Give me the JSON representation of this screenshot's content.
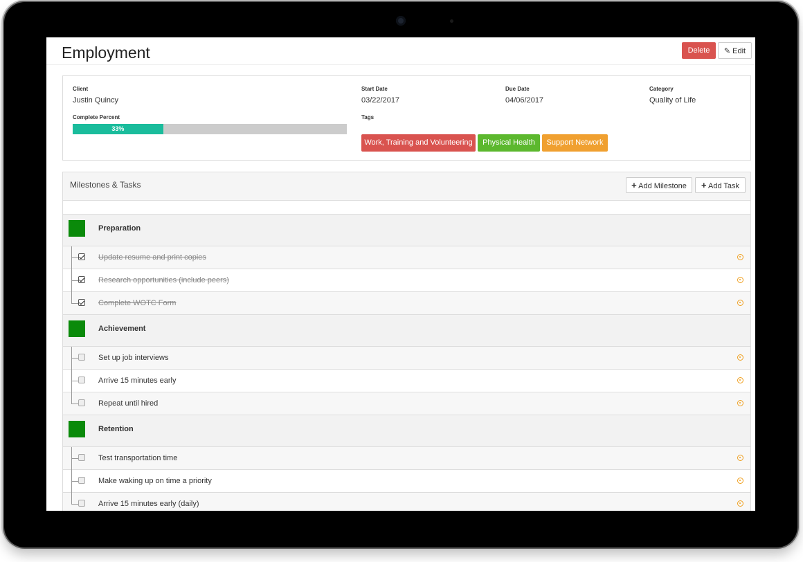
{
  "page": {
    "title": "Employment",
    "delete_label": "Delete",
    "edit_label": "Edit"
  },
  "info": {
    "client_label": "Client",
    "client_value": "Justin Quincy",
    "start_label": "Start Date",
    "start_value": "03/22/2017",
    "due_label": "Due Date",
    "due_value": "04/06/2017",
    "category_label": "Category",
    "category_value": "Quality of Life",
    "complete_label": "Complete Percent",
    "complete_value": "33%",
    "complete_fraction": 0.33,
    "tags_label": "Tags",
    "tags": [
      {
        "label": "Work, Training and Volunteering",
        "color": "#d9534f"
      },
      {
        "label": "Physical Health",
        "color": "#5cb82e"
      },
      {
        "label": "Support Network",
        "color": "#f0a030"
      }
    ]
  },
  "milestones_panel": {
    "title": "Milestones & Tasks",
    "add_milestone_label": "Add Milestone",
    "add_task_label": "Add Task",
    "milestones": [
      {
        "name": "Preparation",
        "color": "#0a8a0a",
        "tasks": [
          {
            "name": "Update resume and print copies",
            "done": true
          },
          {
            "name": "Research opportunities (include peers)",
            "done": true
          },
          {
            "name": "Complete WOTC Form",
            "done": true
          }
        ]
      },
      {
        "name": "Achievement",
        "color": "#0a8a0a",
        "tasks": [
          {
            "name": "Set up job interviews",
            "done": false
          },
          {
            "name": "Arrive 15 minutes early",
            "done": false
          },
          {
            "name": "Repeat until hired",
            "done": false
          }
        ]
      },
      {
        "name": "Retention",
        "color": "#0a8a0a",
        "tasks": [
          {
            "name": "Test transportation time",
            "done": false
          },
          {
            "name": "Make waking up on time a priority",
            "done": false
          },
          {
            "name": "Arrive 15 minutes early (daily)",
            "done": false
          }
        ]
      }
    ]
  }
}
